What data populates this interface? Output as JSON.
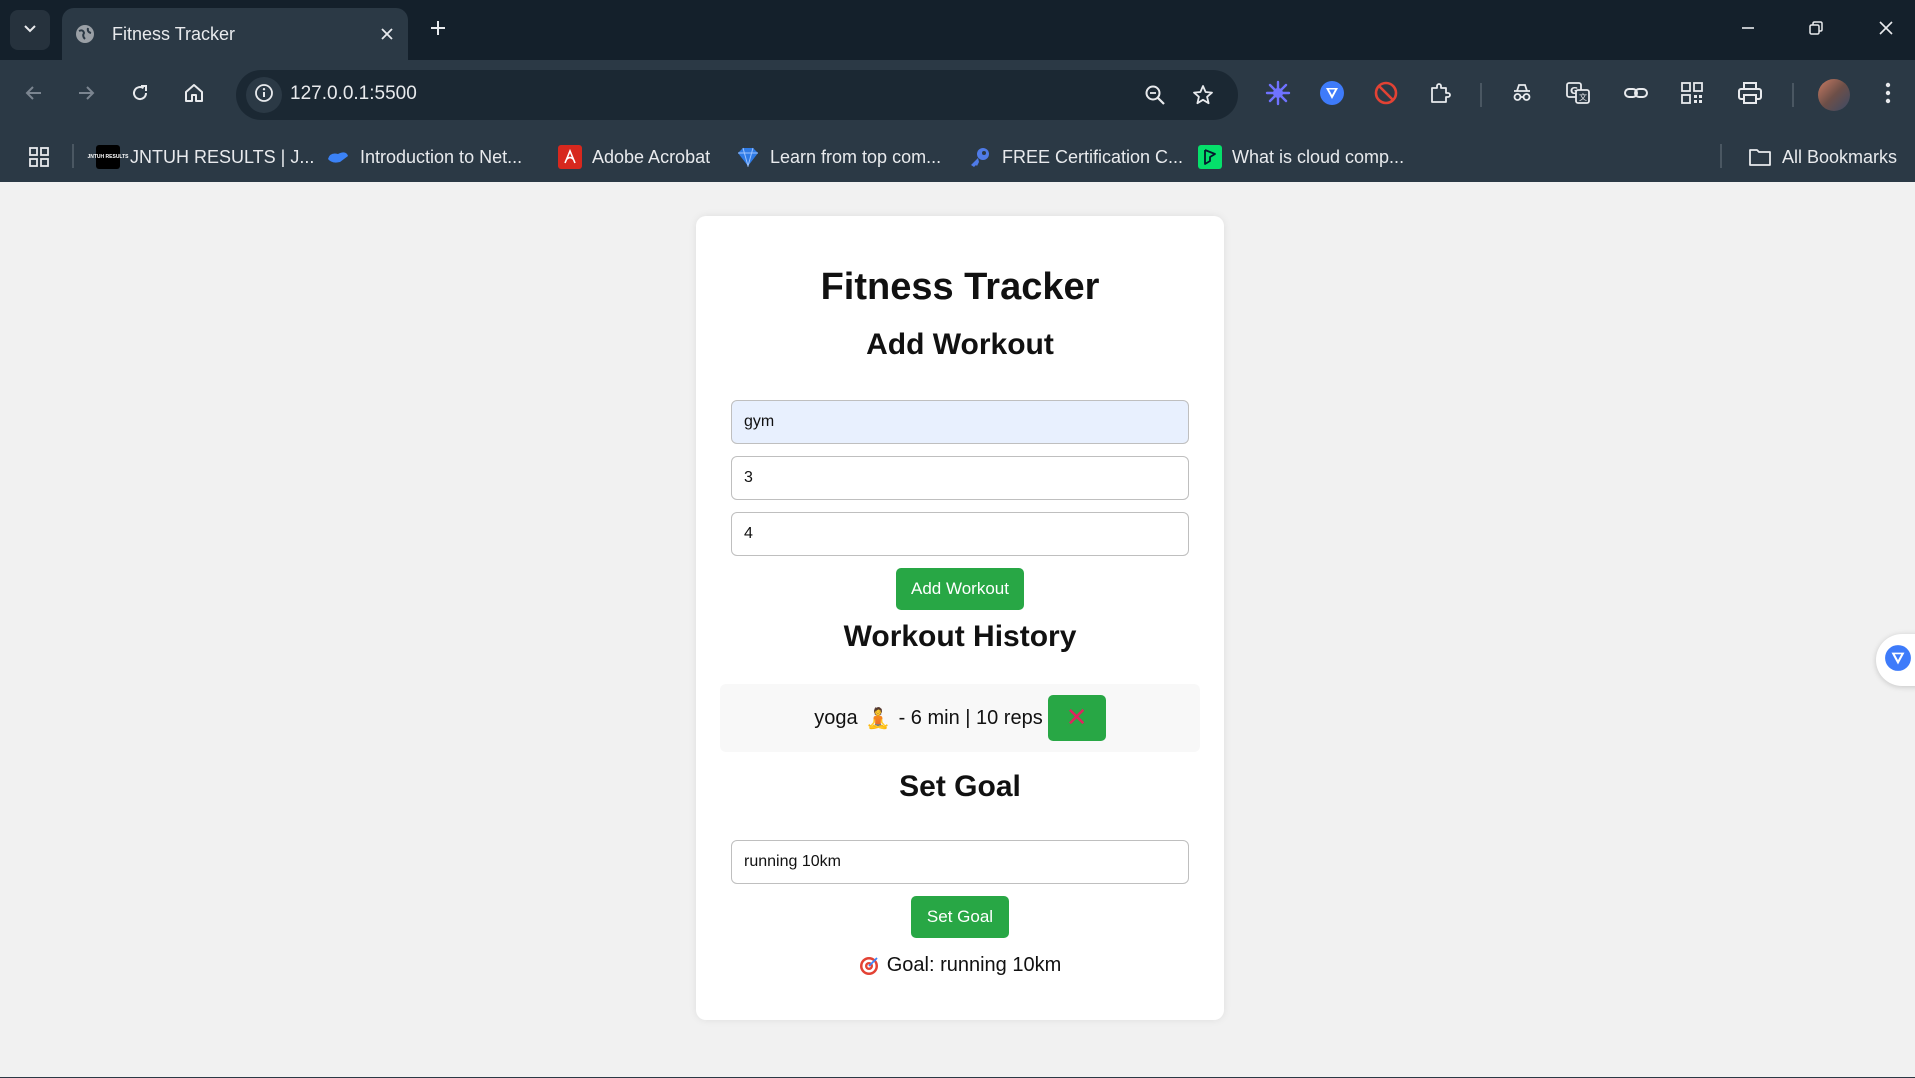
{
  "browser": {
    "tab": {
      "title": "Fitness Tracker",
      "favicon": "globe-icon"
    },
    "address": {
      "url": "127.0.0.1:5500"
    },
    "bookmarks": [
      {
        "label": "JNTUH RESULTS | J...",
        "icon": "jntuh-icon",
        "icon_text": "JNTUH RESULTS"
      },
      {
        "label": "Introduction to Net...",
        "icon": "cloud-icon"
      },
      {
        "label": "Adobe Acrobat",
        "icon": "acrobat-icon"
      },
      {
        "label": "Learn from top com...",
        "icon": "diamond-icon"
      },
      {
        "label": "FREE Certification C...",
        "icon": "key-icon"
      },
      {
        "label": "What is cloud comp...",
        "icon": "datacamp-icon"
      }
    ],
    "all_bookmarks_label": "All Bookmarks"
  },
  "app": {
    "title": "Fitness Tracker",
    "add_workout": {
      "heading": "Add Workout",
      "inputs": [
        {
          "value": "gym"
        },
        {
          "value": "3"
        },
        {
          "value": "4"
        }
      ],
      "button_label": "Add Workout"
    },
    "history": {
      "heading": "Workout History",
      "items": [
        {
          "name": "yoga",
          "emoji": "🧘",
          "details": "- 6 min | 10 reps",
          "delete_glyph": "✕"
        }
      ]
    },
    "goal": {
      "heading": "Set Goal",
      "input_value": "running 10km",
      "button_label": "Set Goal",
      "display_text": "Goal: running 10km",
      "display_icon": "target-icon"
    }
  },
  "colors": {
    "accent_green": "#28a745",
    "chrome_dark": "#14202b",
    "chrome_toolbar": "#2b3945",
    "delete_glyph": "#e0245e"
  }
}
